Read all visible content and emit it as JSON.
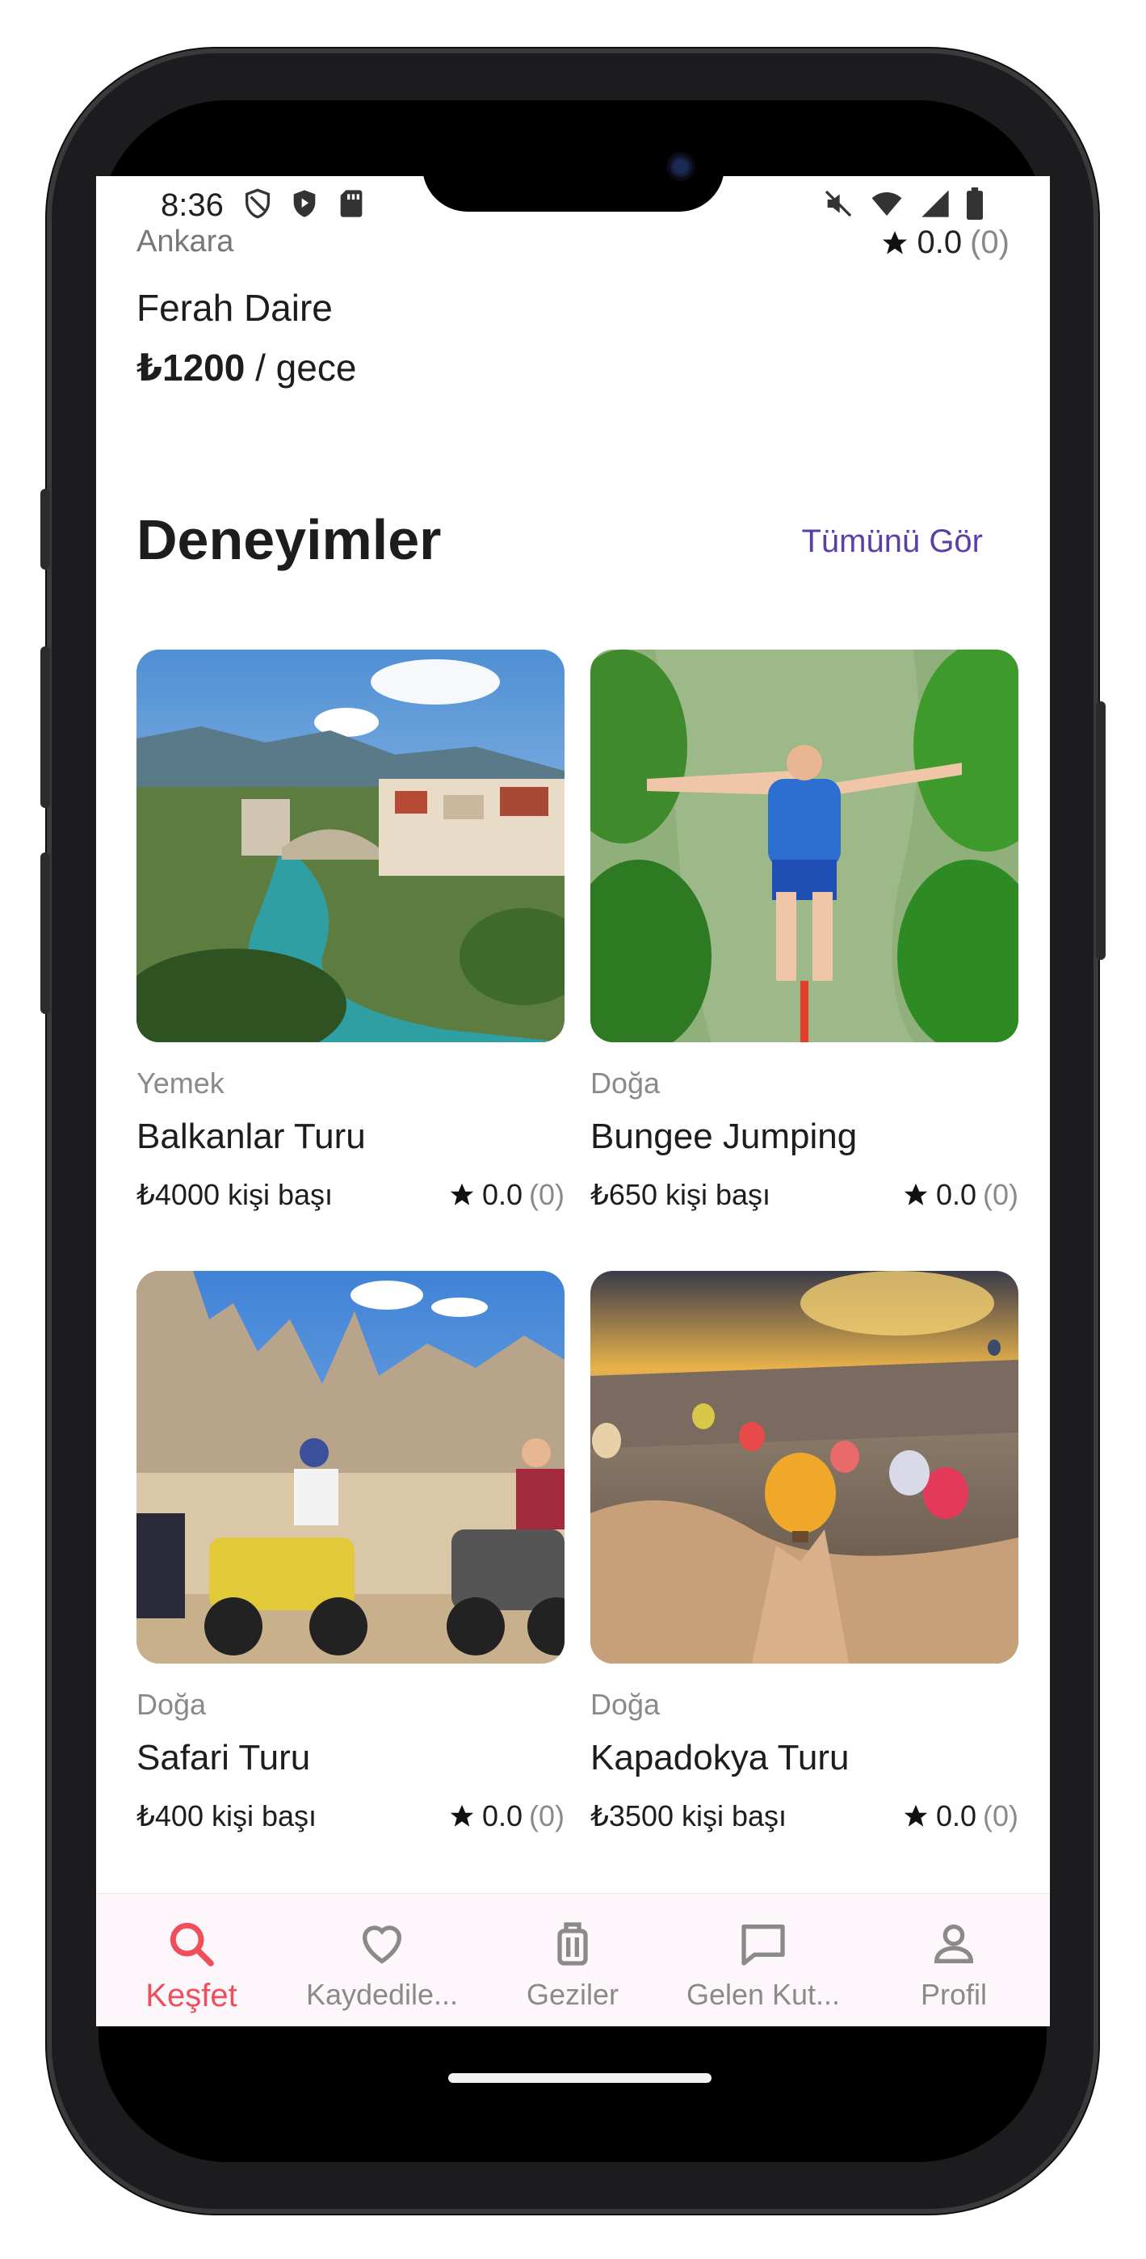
{
  "status_bar": {
    "time": "8:36"
  },
  "previous_listing": {
    "location": "Ankara",
    "title": "Ferah Daire",
    "price": "₺1200",
    "price_unit": " / gece",
    "rating": "0.0",
    "rating_count": "(0)"
  },
  "section": {
    "title": "Deneyimler",
    "see_all": "Tümünü Gör"
  },
  "experiences": [
    {
      "category": "Yemek",
      "name": "Balkanlar Turu",
      "price": "₺4000 kişi başı",
      "rating": "0.0",
      "rating_count": "(0)"
    },
    {
      "category": "Doğa",
      "name": "Bungee Jumping",
      "price": "₺650 kişi başı",
      "rating": "0.0",
      "rating_count": "(0)"
    },
    {
      "category": "Doğa",
      "name": "Safari Turu",
      "price": "₺400 kişi başı",
      "rating": "0.0",
      "rating_count": "(0)"
    },
    {
      "category": "Doğa",
      "name": "Kapadokya Turu",
      "price": "₺3500 kişi başı",
      "rating": "0.0",
      "rating_count": "(0)"
    }
  ],
  "bottom_nav": [
    {
      "label": "Keşfet",
      "icon": "search-icon",
      "active": true
    },
    {
      "label": "Kaydedile...",
      "icon": "heart-icon",
      "active": false
    },
    {
      "label": "Geziler",
      "icon": "luggage-icon",
      "active": false
    },
    {
      "label": "Gelen Kut...",
      "icon": "message-icon",
      "active": false
    },
    {
      "label": "Profil",
      "icon": "user-icon",
      "active": false
    }
  ],
  "colors": {
    "accent": "#ef4e5b",
    "link": "#5b3fa6",
    "muted": "#8a8a8a",
    "text": "#1d1d1d",
    "nav_bg": "#fdf7fb"
  }
}
